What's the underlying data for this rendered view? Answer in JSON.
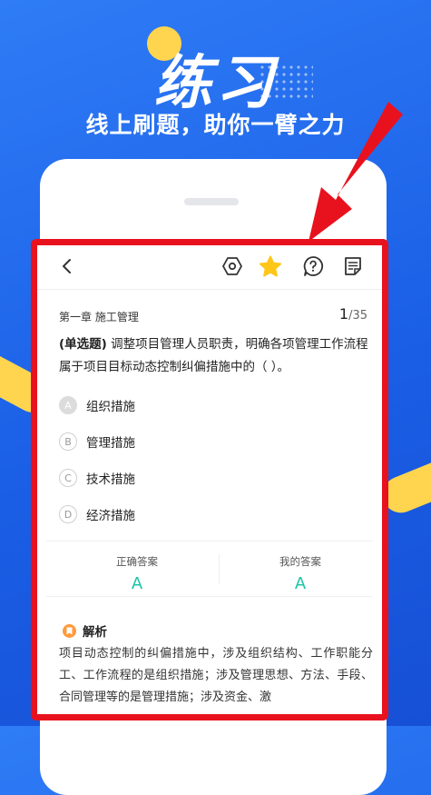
{
  "banner": {
    "title": "练习",
    "subtitle": "线上刷题，助你一臂之力"
  },
  "toolbar": {
    "back_icon": "chevron-left-icon",
    "icons": [
      "settings-hex-icon",
      "star-icon",
      "help-icon",
      "notes-icon"
    ],
    "star_color": "#ffc61a"
  },
  "question": {
    "chapter": "第一章 施工管理",
    "current": "1",
    "total": "/35",
    "type": "(单选题)",
    "text": "调整项目管理人员职责，明确各项管理工作流程属于项目目标动态控制纠偏措施中的（ ）。"
  },
  "options": [
    {
      "letter": "A",
      "text": "组织措施",
      "selected": true
    },
    {
      "letter": "B",
      "text": "管理措施",
      "selected": false
    },
    {
      "letter": "C",
      "text": "技术措施",
      "selected": false
    },
    {
      "letter": "D",
      "text": "经济措施",
      "selected": false
    }
  ],
  "answers": {
    "correct_label": "正确答案",
    "correct_value": "A",
    "mine_label": "我的答案",
    "mine_value": "A",
    "accent_color": "#1bc5a5"
  },
  "analysis": {
    "title": "解析",
    "text": "项目动态控制的纠偏措施中，涉及组织结构、工作职能分工、工作流程的是组织措施；涉及管理思想、方法、手段、合同管理等的是管理措施；涉及资金、激"
  },
  "colors": {
    "background": "#1a5fe6",
    "highlight_frame": "#e8121e",
    "deco_yellow": "#ffd54f"
  }
}
